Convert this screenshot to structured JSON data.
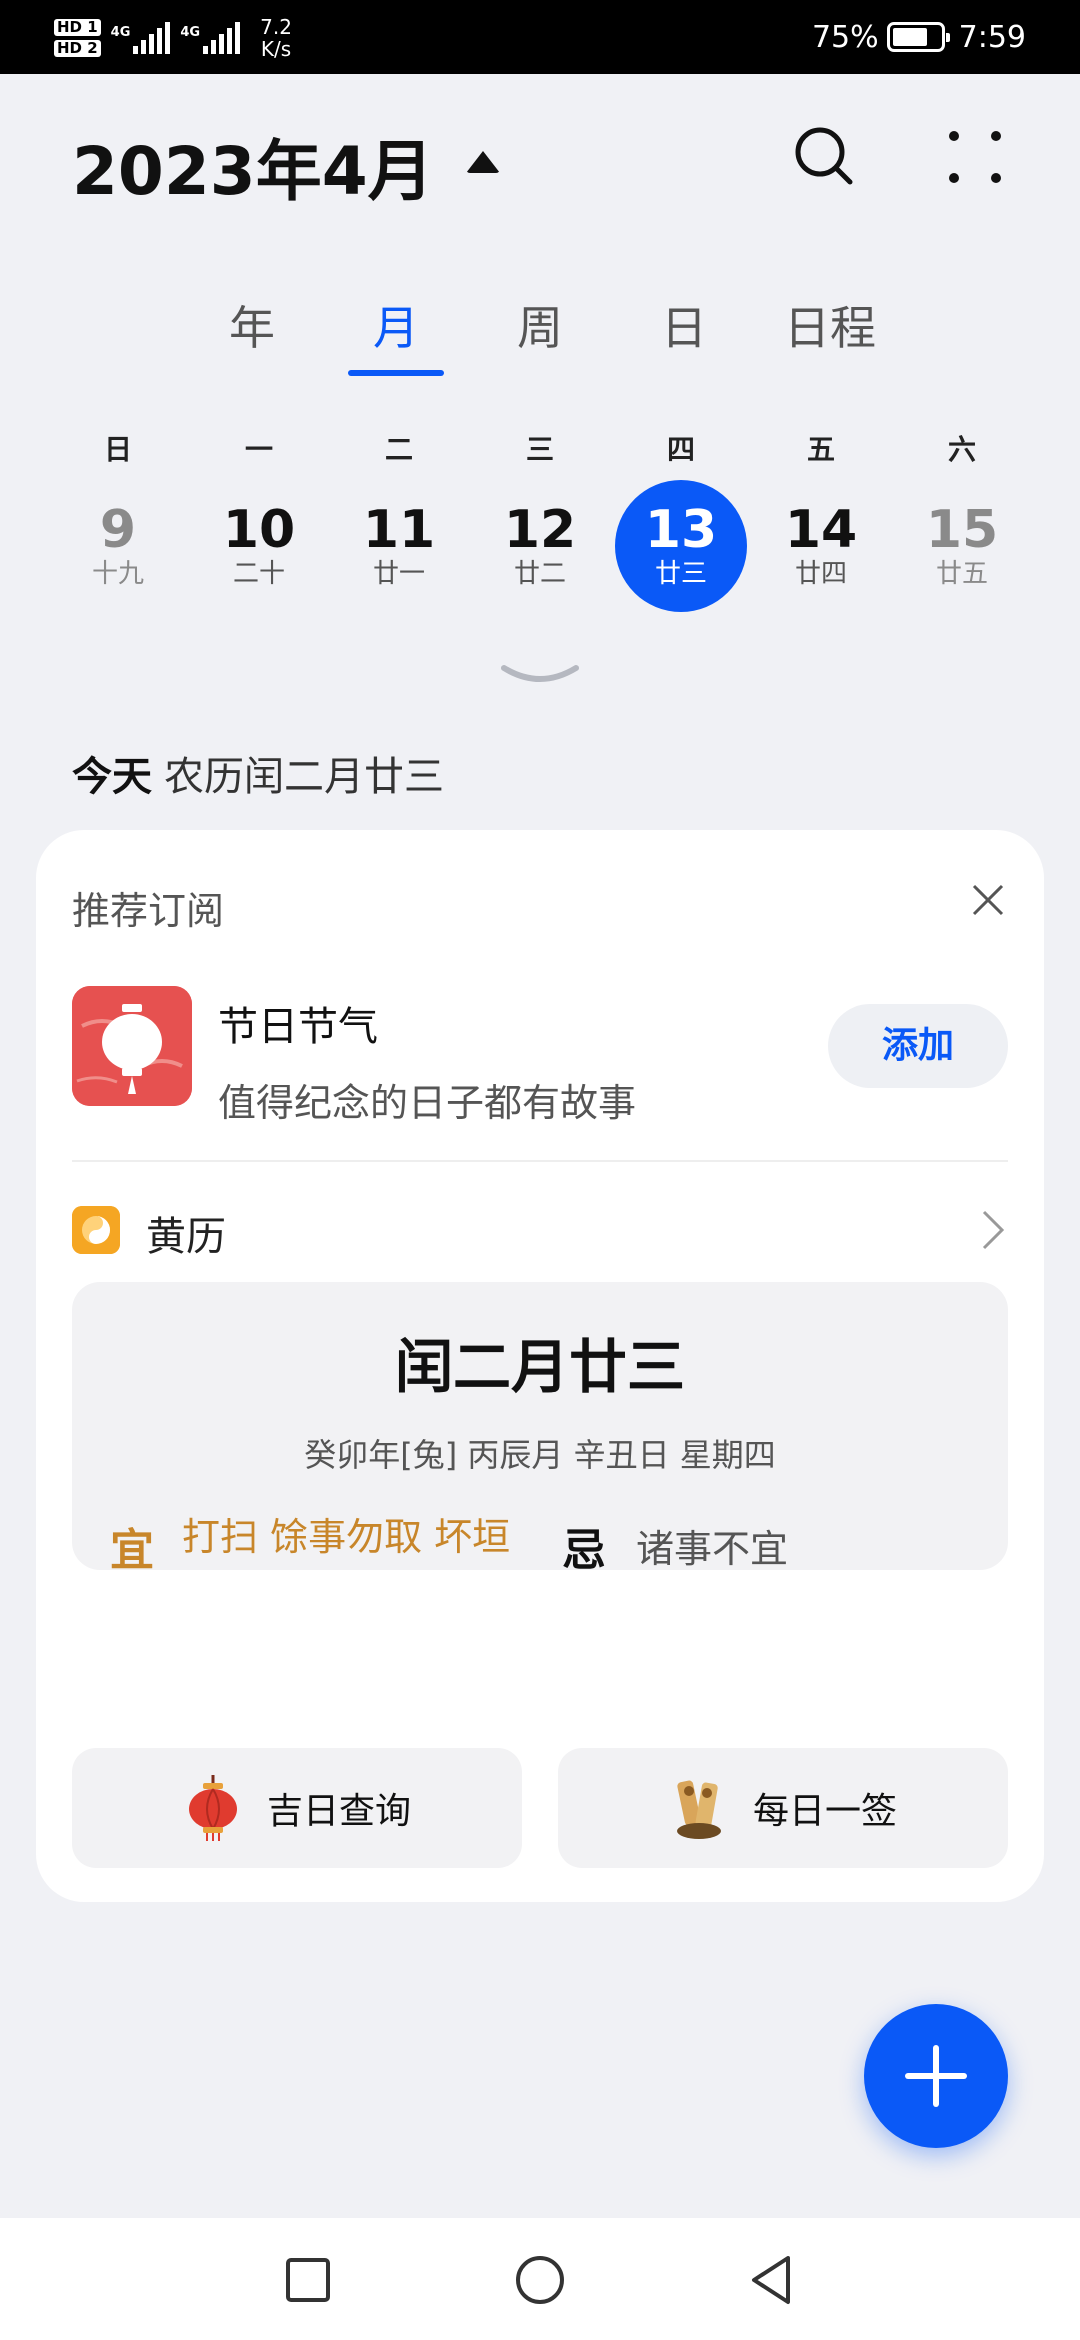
{
  "status_bar": {
    "sim1": "HD 1",
    "sim2": "HD 2",
    "network": "4G",
    "speed_value": "7.2",
    "speed_unit": "K/s",
    "battery_percent": "75%",
    "battery_level": 0.75,
    "time": "7:59"
  },
  "header": {
    "title": "2023年4月",
    "icons": [
      "caret-up-icon",
      "search-icon",
      "more-icon"
    ]
  },
  "view_tabs": [
    {
      "label": "年",
      "active": false
    },
    {
      "label": "月",
      "active": true
    },
    {
      "label": "周",
      "active": false
    },
    {
      "label": "日",
      "active": false
    },
    {
      "label": "日程",
      "active": false
    }
  ],
  "week": {
    "weekdays": [
      "日",
      "一",
      "二",
      "三",
      "四",
      "五",
      "六"
    ],
    "days": [
      {
        "num": "9",
        "lunar": "十九"
      },
      {
        "num": "10",
        "lunar": "二十"
      },
      {
        "num": "11",
        "lunar": "廿一"
      },
      {
        "num": "12",
        "lunar": "廿二"
      },
      {
        "num": "13",
        "lunar": "廿三"
      },
      {
        "num": "14",
        "lunar": "廿四"
      },
      {
        "num": "15",
        "lunar": "廿五"
      }
    ]
  },
  "today": {
    "label": "今天",
    "lunar_date": "农历闰二月廿三"
  },
  "subscription": {
    "heading": "推荐订阅",
    "item_title": "节日节气",
    "item_desc": "值得纪念的日子都有故事",
    "add_label": "添加"
  },
  "almanac": {
    "label": "黄历",
    "main_date": "闰二月廿三",
    "ganzhi": "癸卯年[兔]   丙辰月 辛丑日 星期四",
    "yi_label": "宜",
    "yi_value": "打扫 馀事勿取 坏垣",
    "ji_label": "忌",
    "ji_value": "诸事不宜",
    "buttons": {
      "lucky_day": "吉日查询",
      "daily_draw": "每日一签"
    }
  },
  "colors": {
    "accent": "#0a59f7",
    "almanac_gold": "#c8862a",
    "festival_red": "#e65150"
  }
}
